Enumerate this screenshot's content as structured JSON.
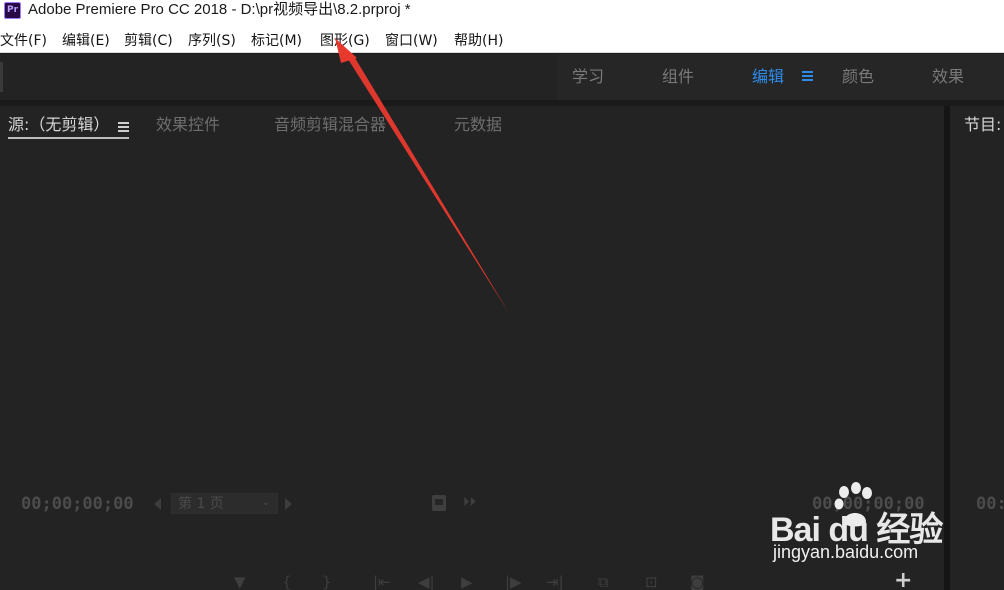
{
  "window": {
    "app_icon_text": "Pr",
    "title": "Adobe Premiere Pro CC 2018 - D:\\pr视频导出\\8.2.prproj *"
  },
  "menu": {
    "items": [
      {
        "label": "文件(F)"
      },
      {
        "label": "编辑(E)"
      },
      {
        "label": "剪辑(C)"
      },
      {
        "label": "序列(S)"
      },
      {
        "label": "标记(M)"
      },
      {
        "label": "图形(G)"
      },
      {
        "label": "窗口(W)"
      },
      {
        "label": "帮助(H)"
      }
    ]
  },
  "workspaces": {
    "tabs": [
      {
        "label": "学习",
        "active": false
      },
      {
        "label": "组件",
        "active": false
      },
      {
        "label": "编辑",
        "active": true
      },
      {
        "label": "颜色",
        "active": false
      },
      {
        "label": "效果",
        "active": false
      }
    ],
    "active_color": "#2d8ceb"
  },
  "source_panel": {
    "tabs": [
      {
        "label": "源:（无剪辑）",
        "active": true
      },
      {
        "label": "效果控件",
        "active": false
      },
      {
        "label": "音频剪辑混合器",
        "active": false
      },
      {
        "label": "元数据",
        "active": false
      }
    ],
    "timecode_in": "00;00;00;00",
    "timecode_out": "00;00;00;00",
    "page_select": "第 1 页",
    "add_button": "+"
  },
  "program_panel": {
    "tab_label": "节目:",
    "timecode": "00:"
  },
  "watermark": {
    "logo_text": "Bai du 经验",
    "url": "jingyan.baidu.com"
  },
  "annotation": {
    "color": "#e8392f",
    "description": "red arrow pointing to 图形(G) menu"
  }
}
